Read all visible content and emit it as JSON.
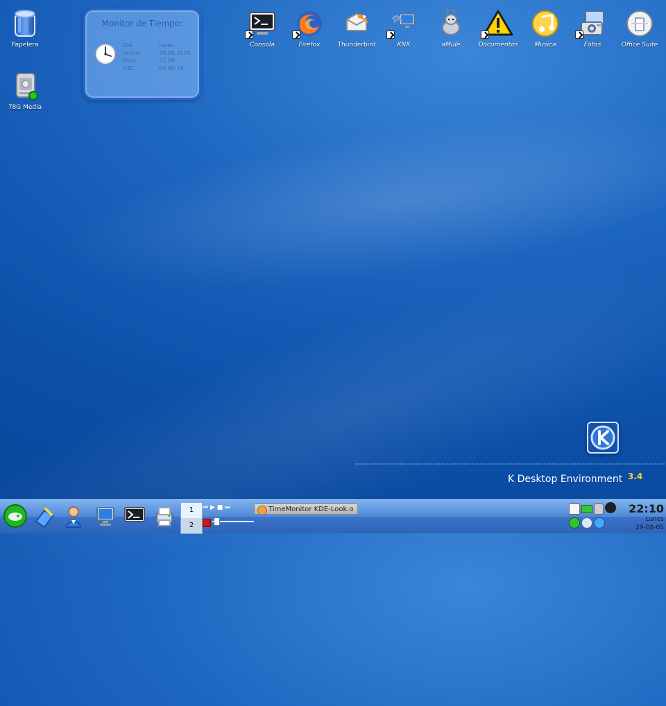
{
  "desktop": {
    "left_icons": [
      {
        "label": "Papelera"
      },
      {
        "label": "78G Media"
      }
    ],
    "top_icons": [
      {
        "label": "Consola",
        "italic": true,
        "shortcut": true
      },
      {
        "label": "Firefox",
        "italic": true,
        "shortcut": true
      },
      {
        "label": "Thunderbird",
        "italic": false,
        "shortcut": false
      },
      {
        "label": "KNX",
        "italic": true,
        "shortcut": true
      },
      {
        "label": "aMule",
        "italic": true,
        "shortcut": false
      },
      {
        "label": "Documentos",
        "italic": true,
        "shortcut": true
      },
      {
        "label": "Musica",
        "italic": true,
        "shortcut": false
      },
      {
        "label": "Fotos",
        "italic": true,
        "shortcut": true
      },
      {
        "label": "Office Suite",
        "italic": true,
        "shortcut": false
      }
    ]
  },
  "widget": {
    "title": "Monitor de Tiempo:",
    "rows": [
      {
        "label": "Día:",
        "value": "lunes"
      },
      {
        "label": "Fecha:",
        "value": "29.08.2005"
      },
      {
        "label": "Hora:",
        "value": "22:09"
      },
      {
        "label": "UTC",
        "value": "0d 00:19"
      }
    ]
  },
  "branding": {
    "text": "K Desktop Environment",
    "version": "3.4"
  },
  "taskbar": {
    "pager": {
      "desk1": "1",
      "desk2": "2"
    },
    "active_task": "TimeMonitor KDE-Look.o",
    "clock": {
      "time": "22:10",
      "day": "Lunes",
      "date": "29-08-05"
    }
  }
}
